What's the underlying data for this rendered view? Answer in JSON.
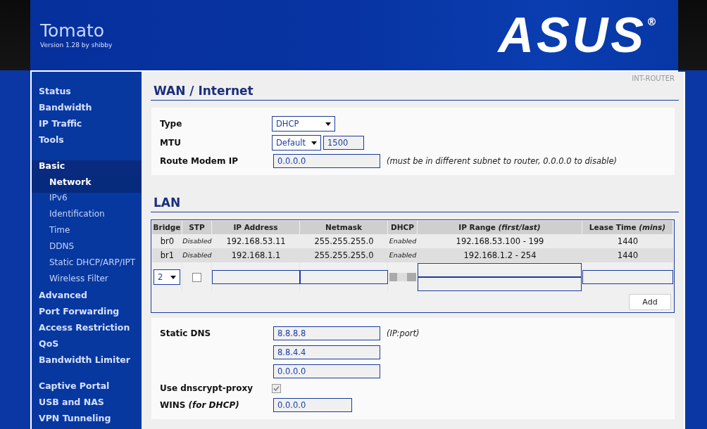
{
  "header": {
    "title": "Tomato",
    "subtitle": "Version 1.28 by shibby",
    "logo": "ASUS",
    "logo_mark": "®"
  },
  "sidebar": {
    "groups": [
      {
        "items": [
          {
            "label": "Status",
            "selected": false
          },
          {
            "label": "Bandwidth",
            "selected": false
          },
          {
            "label": "IP Traffic",
            "selected": false
          },
          {
            "label": "Tools",
            "selected": false
          }
        ]
      },
      {
        "items": [
          {
            "label": "Basic",
            "selected": true,
            "expanded": true,
            "children": [
              {
                "label": "Network",
                "selected": true
              },
              {
                "label": "IPv6",
                "selected": false
              },
              {
                "label": "Identification",
                "selected": false
              },
              {
                "label": "Time",
                "selected": false
              },
              {
                "label": "DDNS",
                "selected": false
              },
              {
                "label": "Static DHCP/ARP/IPT",
                "selected": false
              },
              {
                "label": "Wireless Filter",
                "selected": false
              }
            ]
          },
          {
            "label": "Advanced",
            "selected": false
          },
          {
            "label": "Port Forwarding",
            "selected": false
          },
          {
            "label": "Access Restriction",
            "selected": false
          },
          {
            "label": "QoS",
            "selected": false
          },
          {
            "label": "Bandwidth Limiter",
            "selected": false
          }
        ]
      },
      {
        "items": [
          {
            "label": "Captive Portal",
            "selected": false
          },
          {
            "label": "USB and NAS",
            "selected": false
          },
          {
            "label": "VPN Tunneling",
            "selected": false
          }
        ]
      }
    ]
  },
  "router_name": "INT-ROUTER",
  "wan": {
    "title": "WAN / Internet",
    "fields": [
      {
        "kind": "select",
        "label": "Type",
        "value": "DHCP"
      },
      {
        "kind": "select-input",
        "label": "MTU",
        "value": "Default",
        "extra_value": "1500"
      },
      {
        "kind": "input",
        "label": "Route Modem IP",
        "value": "0.0.0.0",
        "note": "(must be in different subnet to router, 0.0.0.0 to disable)"
      }
    ]
  },
  "lan": {
    "title": "LAN",
    "table": {
      "columns": [
        {
          "label": "Bridge",
          "kind": "text"
        },
        {
          "label": "STP",
          "kind": "flag"
        },
        {
          "label": "IP Address",
          "kind": "text"
        },
        {
          "label": "Netmask",
          "kind": "text"
        },
        {
          "label": "DHCP",
          "kind": "flag"
        },
        {
          "label": "IP Range *(first/last)*",
          "kind": "text"
        },
        {
          "label": "Lease Time *(mins)*",
          "kind": "text"
        }
      ],
      "rows": [
        [
          "br0",
          "Disabled",
          "192.168.53.11",
          "255.255.255.0",
          "Enabled",
          "192.168.53.100 - 199",
          "1440"
        ],
        [
          "br1",
          "Disabled",
          "192.168.1.1",
          "255.255.255.0",
          "Enabled",
          "192.168.1.2 - 254",
          "1440"
        ]
      ]
    },
    "new_row": {
      "bridge": "2",
      "stp_checked": false,
      "dhcp_disabled": true
    },
    "add_button": "Add"
  },
  "dns": {
    "fields": [
      {
        "kind": "input",
        "label": "Static DNS",
        "value": "8.8.8.8",
        "note": "(IP:port)"
      },
      {
        "kind": "input",
        "value": "8.8.4.4"
      },
      {
        "kind": "input",
        "value": "0.0.0.0"
      },
      {
        "kind": "checkbox",
        "label": "Use dnscrypt-proxy",
        "checked": true,
        "disabled": true
      },
      {
        "kind": "short-input",
        "label": "WINS *(for DHCP)*",
        "value": "0.0.0.0"
      }
    ]
  }
}
